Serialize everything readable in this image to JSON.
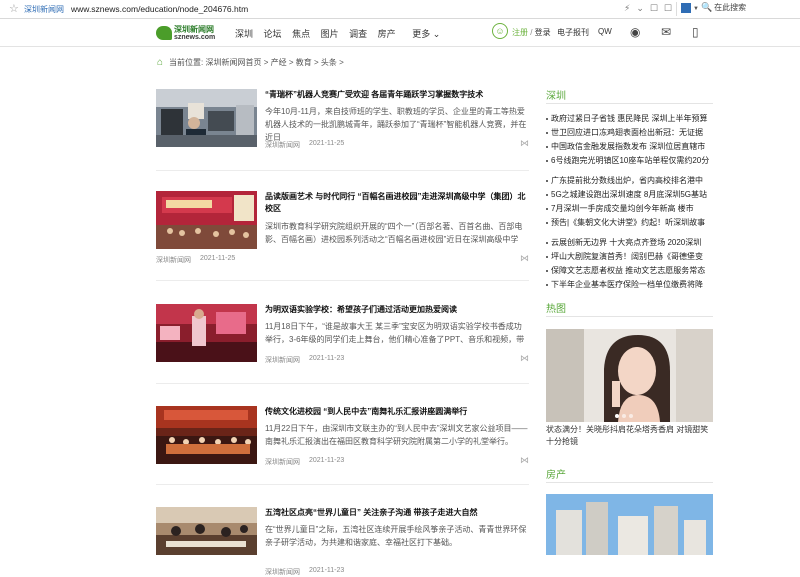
{
  "browser": {
    "site_tag": "深圳新闻网",
    "url": "www.sznews.com/education/node_204676.htm",
    "search_placeholder": "在此搜索"
  },
  "logo": {
    "cn": "深圳新闻网",
    "en": "sznews.com"
  },
  "nav": {
    "items": [
      "深圳",
      "论坛",
      "焦点",
      "图片",
      "调查",
      "房产"
    ],
    "more": "更多 ⌄",
    "login": "注册",
    "login_sep": " / ",
    "login2": "登录",
    "epaper": "电子报刊",
    "qw": "QW"
  },
  "breadcrumb": "当前位置:   深圳新闻网首页  >  产经  >  教育  >  头条  >",
  "articles": [
    {
      "title": "“青瑞杯”机器人竞赛广受欢迎 各届青年踊跃学习掌握数字技术",
      "summary": "今年10月-11月，来自技师班的学生、职教班的学员、企业里的青工等热爱机器人技术的一批凯鹏城青年，踊跃参加了“青瑞杯”智能机器人竞赛，并在近日",
      "source": "深圳新闻网",
      "date": "2021-11-25"
    },
    {
      "title": "品读版画艺术 与时代同行 “百幅名画进校园”走进深圳高级中学（集团）北校区",
      "summary": "深圳市教育科学研究院组织开展的“四个一”（百部名著、百首名曲、百部电影、百幅名画）进校园系列活动之“百幅名画进校园”近日在深圳高级中学（集",
      "source": "深圳新闻网",
      "date": "2021-11-25"
    },
    {
      "title": "为明双语实验学校：希望孩子们通过活动更加热爱阅读",
      "summary": "11月18日下午，“谁是故事大王 某三季”宝安区为明双语实验学校书香成功举行，3-6年级的同学们走上舞台，他们精心准备了PPT、音乐和视频，带着相",
      "source": "深圳新闻网",
      "date": "2021-11-23"
    },
    {
      "title": "传统文化进校园 “到人民中去”南舞礼乐汇报讲座圆满举行",
      "summary": "11月22日下午，由深圳市文联主办的“到人民中去”深圳文艺家公益项目——南舞礼乐汇报演出在福田区教育科学研究院附属第二小学的礼堂举行。",
      "source": "深圳新闻网",
      "date": "2021-11-23"
    },
    {
      "title": "五湾社区点亮“世界儿童日” 关注亲子沟通 带孩子走进大自然",
      "summary": "在“世界儿童日”之际，五湾社区连续开展手绘风筝亲子活动、青青世界环保亲子研学活动，为共建和谐家庭、幸福社区打下基础。",
      "source": "深圳新闻网",
      "date": "2021-11-23"
    }
  ],
  "sidebar": {
    "shenzhen_title": "深圳",
    "list1": [
      "政府过紧日子省钱 惠民降民 深圳上半年预算",
      "世卫回应进口冻鸡翅表面检出新冠：无证据",
      "中国政信金融发展指数发布 深圳位居直辖市",
      "6号线跑完光明镇区10座车站单程仅需约20分"
    ],
    "list2": [
      "广东提前批分数线出炉，省内高校排名港中",
      "5G之城建设跑出深圳速度 8月底深圳5G基站",
      "7月深圳一手房成交量均创今年新高 楼市",
      "预告|《集朝文化大讲堂》约起！听深圳故事"
    ],
    "list3": [
      "云展创新无边界 十大亮点齐登场 2020深圳",
      "坪山大剧院复演首秀！阔别巴赫《哥德堡变",
      "保障文艺志愿者权益 推动文艺志愿服务常态",
      "下半年企业基本医疗保险一档单位缴费将降"
    ],
    "hot_title": "热图",
    "hot_caption": "状态满分！关晓彤抖肩花朵塔秀香肩 对镜甜笑十分抢镜",
    "house_title": "房产"
  }
}
